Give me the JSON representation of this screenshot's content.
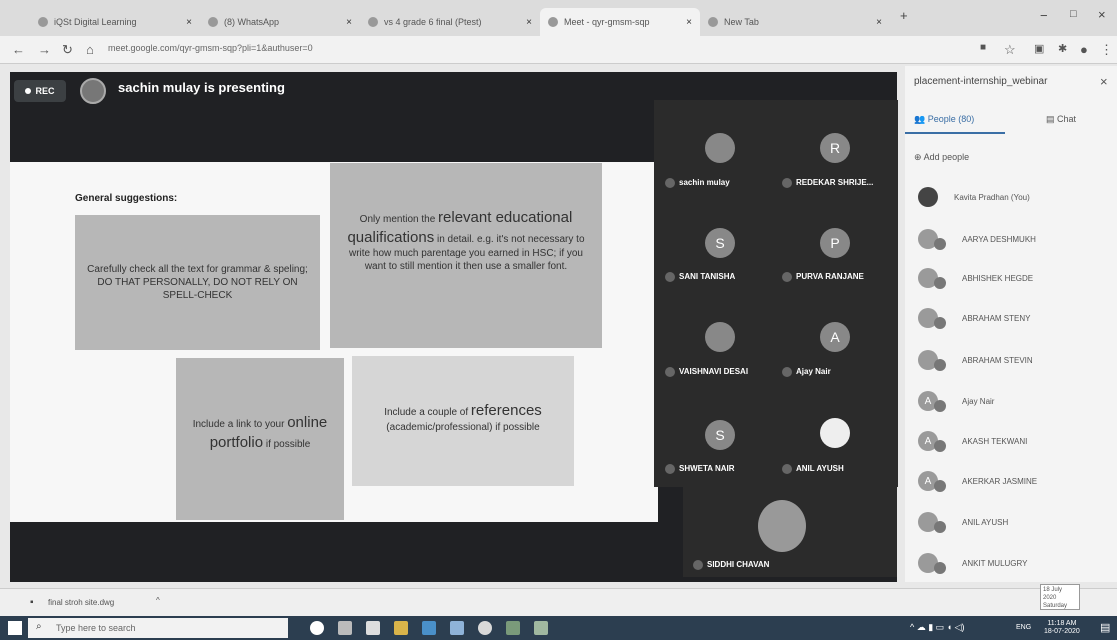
{
  "tabs": [
    {
      "label": "iQSt Digital Learning"
    },
    {
      "label": "(8) WhatsApp"
    },
    {
      "label": "vs 4 grade 6 final (Ptest)"
    },
    {
      "label": "Meet - qyr-gmsm-sqp"
    },
    {
      "label": "New Tab"
    }
  ],
  "address": {
    "url": "meet.google.com/qyr-gmsm-sqp?pli=1&authuser=0"
  },
  "meeting": {
    "rec_label": "REC",
    "presenter_text": "sachin mulay is presenting"
  },
  "slide": {
    "heading": "General suggestions:",
    "box1": "Carefully check all the text for grammar & speling; DO THAT PERSONALLY, DO NOT RELY ON SPELL-CHECK",
    "box2_a": "Only mention the ",
    "box2_big": "relevant educational qualifications",
    "box2_b": " in detail. e.g. it's not necessary to write how much parentage you earned in HSC; if you want to still mention it then use a smaller font.",
    "box3_a": "Include a link to your ",
    "box3_big": "online portfolio",
    "box3_b": " if possible",
    "box4_a": "Include a couple of ",
    "box4_big": "references",
    "box4_b": " (academic/professional) if possible"
  },
  "tiles": [
    {
      "name": "sachin mulay",
      "initial": "",
      "color": "#777777"
    },
    {
      "name": "REDEKAR SHRIJE...",
      "initial": "R",
      "color": "#8a8a8a"
    },
    {
      "name": "SANI TANISHA",
      "initial": "S",
      "color": "#8a8a8a"
    },
    {
      "name": "PURVA RANJANE",
      "initial": "P",
      "color": "#8a8a8a"
    },
    {
      "name": "VAISHNAVI DESAI",
      "initial": "",
      "color": "#777777"
    },
    {
      "name": "Ajay Nair",
      "initial": "A",
      "color": "#8a8a8a"
    },
    {
      "name": "SHWETA NAIR",
      "initial": "S",
      "color": "#8a8a8a"
    },
    {
      "name": "ANIL AYUSH",
      "initial": "",
      "color": "#eeeeee"
    }
  ],
  "self_tile": {
    "name": "SIDDHI CHAVAN"
  },
  "panel": {
    "title": "placement-internship_webinar",
    "people_tab": "People (80)",
    "chat_tab": "Chat",
    "add_people": "Add people",
    "people": [
      {
        "name": "Kavita Pradhan (You)",
        "initial": ""
      },
      {
        "name": "AARYA DESHMUKH",
        "initial": ""
      },
      {
        "name": "ABHISHEK HEGDE",
        "initial": ""
      },
      {
        "name": "ABRAHAM STENY",
        "initial": ""
      },
      {
        "name": "ABRAHAM STEVIN",
        "initial": ""
      },
      {
        "name": "Ajay Nair",
        "initial": "A"
      },
      {
        "name": "AKASH TEKWANI",
        "initial": "A"
      },
      {
        "name": "AKERKAR JASMINE",
        "initial": "A"
      },
      {
        "name": "ANIL AYUSH",
        "initial": ""
      },
      {
        "name": "ANKIT MULUGRY",
        "initial": ""
      }
    ]
  },
  "download": {
    "file": "final stroh site.dwg"
  },
  "taskbar": {
    "search": "Type here to search",
    "lang": "ENG",
    "time": "11:18 AM",
    "date": "18-07-2020"
  },
  "popup": {
    "line1": "18 July 2020",
    "line2": "Saturday"
  }
}
